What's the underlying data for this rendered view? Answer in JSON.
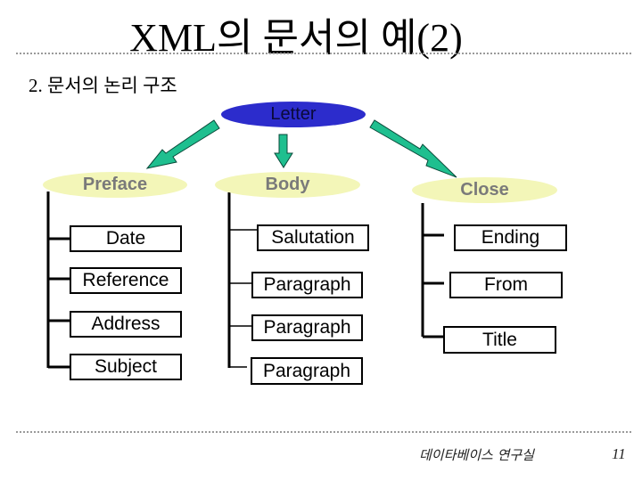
{
  "slide": {
    "title": "XML의 문서의 예(2)",
    "subtitle": "2. 문서의 논리  구조",
    "footer": "데이타베이스 연구실",
    "page_number": "11"
  },
  "colors": {
    "root_fill": "#2c2ccc",
    "section_fill": "#f3f6b8",
    "arrow_fill": "#1fbf8f"
  },
  "tree": {
    "root": "Letter",
    "sections": [
      {
        "label": "Preface",
        "children": [
          "Date",
          "Reference",
          "Address",
          "Subject"
        ]
      },
      {
        "label": "Body",
        "children": [
          "Salutation",
          "Paragraph",
          "Paragraph",
          "Paragraph"
        ]
      },
      {
        "label": "Close",
        "children": [
          "Ending",
          "From",
          "Title"
        ]
      }
    ]
  }
}
